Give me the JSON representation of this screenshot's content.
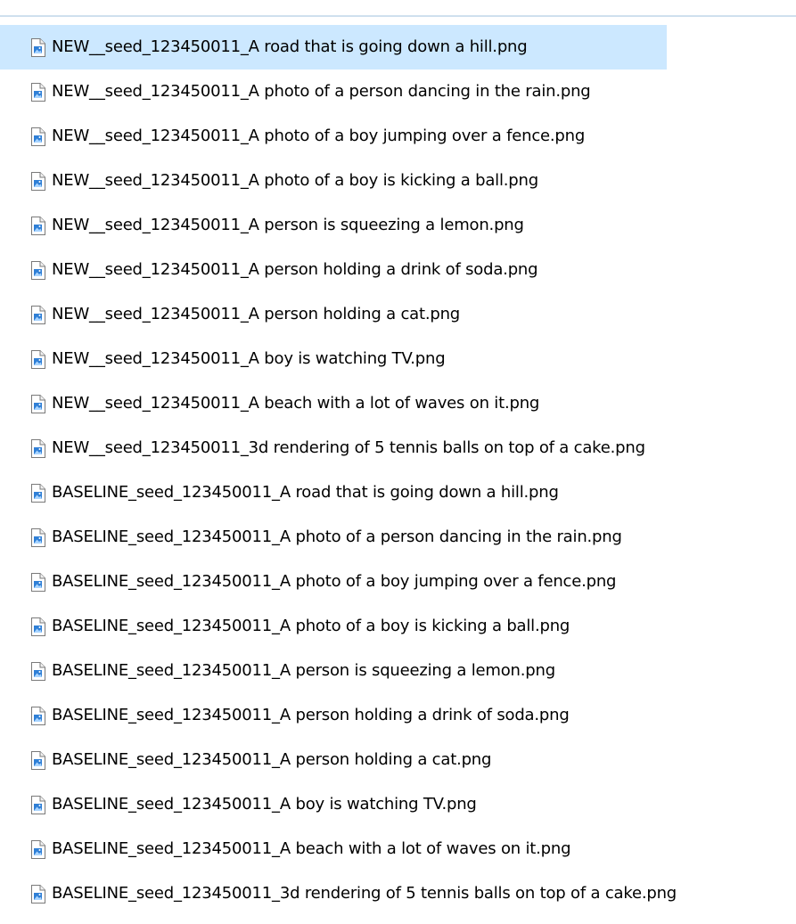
{
  "files": [
    {
      "name": "NEW__seed_123450011_A road that is going down a hill.png",
      "selected": true,
      "icon": "image-file-icon"
    },
    {
      "name": "NEW__seed_123450011_A photo of a person dancing in the rain.png",
      "selected": false,
      "icon": "image-file-icon"
    },
    {
      "name": "NEW__seed_123450011_A photo of a boy jumping over a fence.png",
      "selected": false,
      "icon": "image-file-icon"
    },
    {
      "name": "NEW__seed_123450011_A photo of a boy is kicking a ball.png",
      "selected": false,
      "icon": "image-file-icon"
    },
    {
      "name": "NEW__seed_123450011_A person is squeezing a lemon.png",
      "selected": false,
      "icon": "image-file-icon"
    },
    {
      "name": "NEW__seed_123450011_A person holding a drink of soda.png",
      "selected": false,
      "icon": "image-file-icon"
    },
    {
      "name": "NEW__seed_123450011_A person holding a cat.png",
      "selected": false,
      "icon": "image-file-icon"
    },
    {
      "name": "NEW__seed_123450011_A boy is watching TV.png",
      "selected": false,
      "icon": "image-file-icon"
    },
    {
      "name": "NEW__seed_123450011_A beach with a lot of waves on it.png",
      "selected": false,
      "icon": "image-file-icon"
    },
    {
      "name": "NEW__seed_123450011_3d rendering of 5 tennis balls on top of a cake.png",
      "selected": false,
      "icon": "image-file-icon"
    },
    {
      "name": "BASELINE_seed_123450011_A road that is going down a hill.png",
      "selected": false,
      "icon": "image-file-icon"
    },
    {
      "name": "BASELINE_seed_123450011_A photo of a person dancing in the rain.png",
      "selected": false,
      "icon": "image-file-icon"
    },
    {
      "name": "BASELINE_seed_123450011_A photo of a boy jumping over a fence.png",
      "selected": false,
      "icon": "image-file-icon"
    },
    {
      "name": "BASELINE_seed_123450011_A photo of a boy is kicking a ball.png",
      "selected": false,
      "icon": "image-file-icon"
    },
    {
      "name": "BASELINE_seed_123450011_A person is squeezing a lemon.png",
      "selected": false,
      "icon": "image-file-icon"
    },
    {
      "name": "BASELINE_seed_123450011_A person holding a drink of soda.png",
      "selected": false,
      "icon": "image-file-icon"
    },
    {
      "name": "BASELINE_seed_123450011_A person holding a cat.png",
      "selected": false,
      "icon": "image-file-icon"
    },
    {
      "name": "BASELINE_seed_123450011_A boy is watching TV.png",
      "selected": false,
      "icon": "image-file-icon"
    },
    {
      "name": "BASELINE_seed_123450011_A beach with a lot of waves on it.png",
      "selected": false,
      "icon": "image-file-icon"
    },
    {
      "name": "BASELINE_seed_123450011_3d rendering of 5 tennis balls on top of a cake.png",
      "selected": false,
      "icon": "image-file-icon"
    }
  ],
  "colors": {
    "selection_bg": "#cce8ff",
    "divider": "#cfe0ee",
    "icon_accent": "#2f7fd6"
  }
}
